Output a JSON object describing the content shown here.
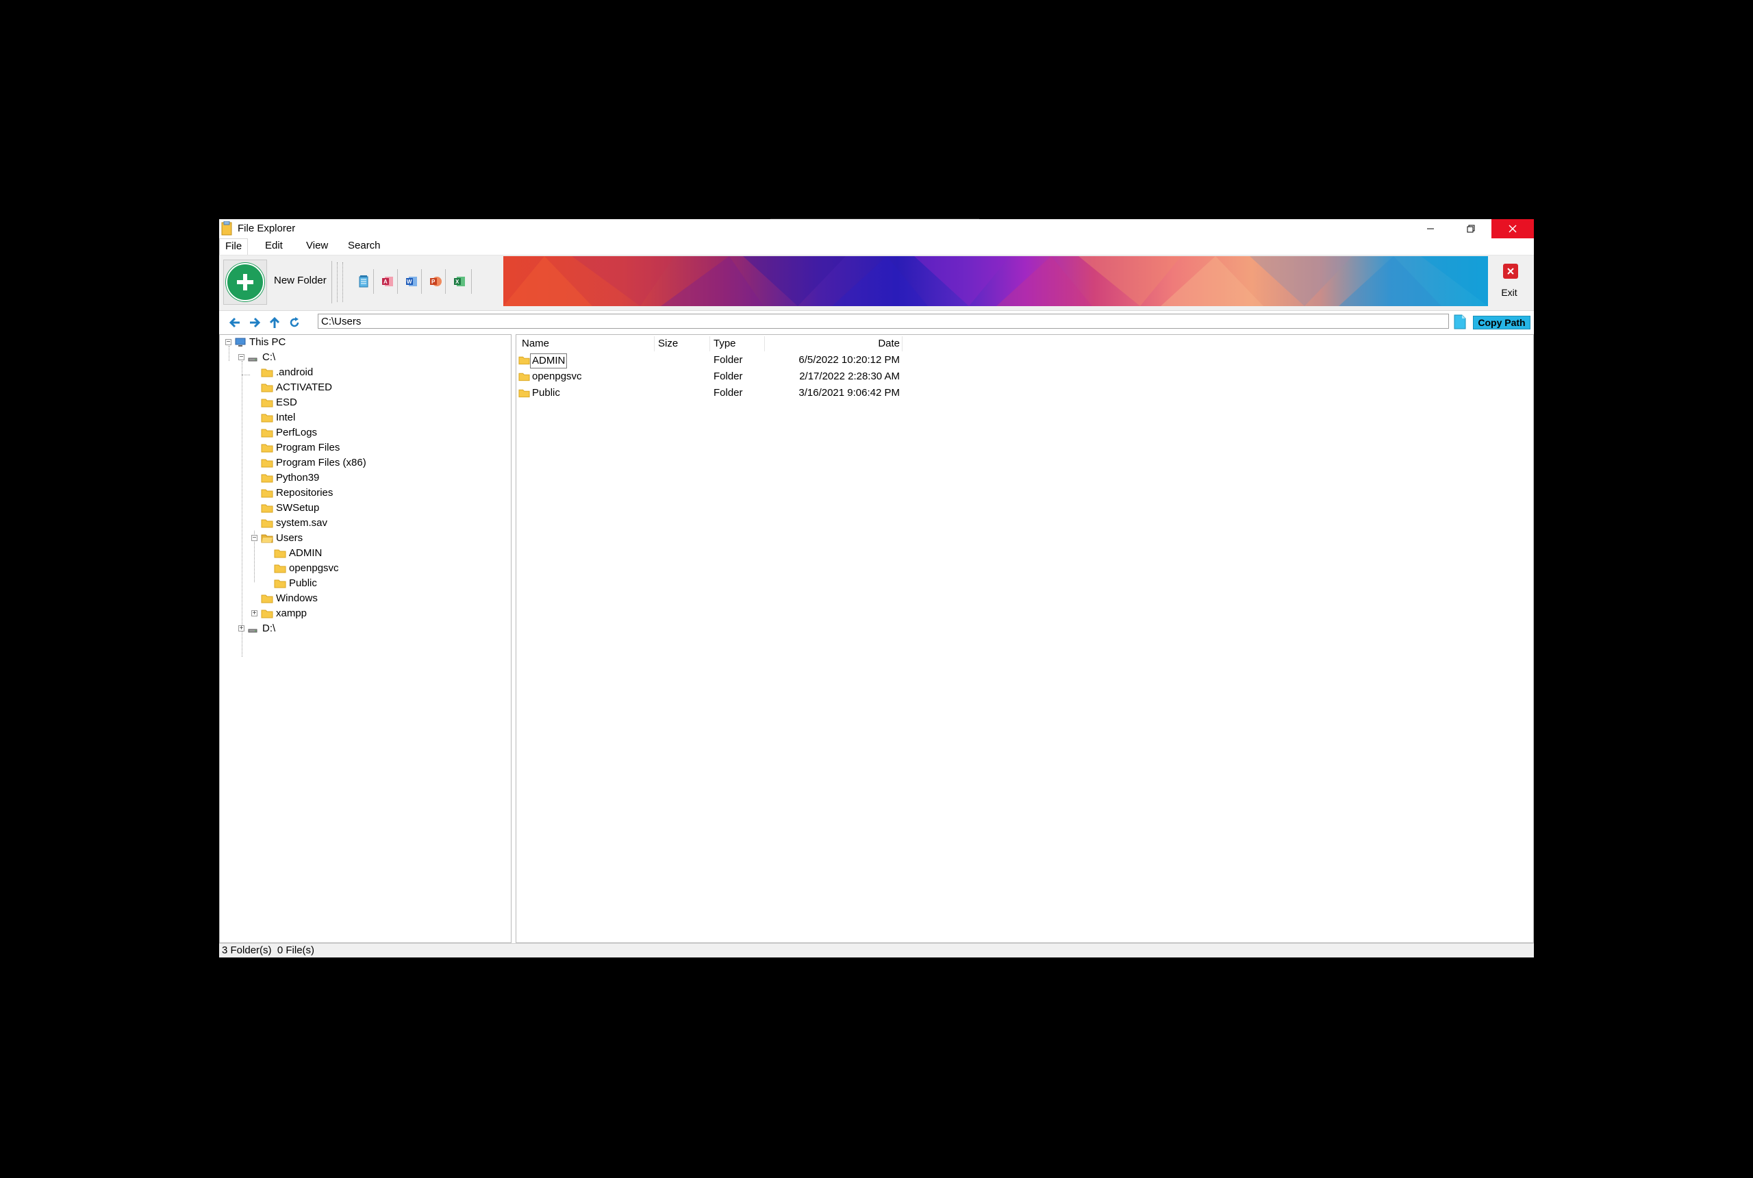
{
  "window": {
    "title": "File Explorer",
    "icons": {
      "app": "folder-app-icon",
      "minimize": "minimize-icon",
      "maximize": "restore-icon",
      "close": "close-icon"
    },
    "close_color": "#e81123"
  },
  "menu": {
    "items": [
      "File",
      "Edit",
      "View",
      "Search"
    ],
    "active": "File"
  },
  "toolbar": {
    "new_folder_label": "New Folder",
    "new_folder_color": "#1e9e5a",
    "apps": [
      "notepad-icon",
      "access-icon",
      "word-icon",
      "powerpoint-icon",
      "excel-icon"
    ],
    "exit_label": "Exit"
  },
  "address": {
    "path": "C:\\Users",
    "copy_label": "Copy Path",
    "copy_color": "#26b5e6",
    "nav_icons": [
      "back-arrow-icon",
      "forward-arrow-icon",
      "up-arrow-icon",
      "refresh-icon"
    ]
  },
  "tree": {
    "root": "This PC",
    "drive_c": "C:\\",
    "c_children": [
      ".android",
      "ACTIVATED",
      "ESD",
      "Intel",
      "PerfLogs",
      "Program Files",
      "Program Files (x86)",
      "Python39",
      "Repositories",
      "SWSetup",
      "system.sav",
      "Users",
      "Windows",
      "xampp"
    ],
    "users_children": [
      "ADMIN",
      "openpgsvc",
      "Public"
    ],
    "drive_d": "D:\\"
  },
  "list": {
    "columns": [
      "Name",
      "Size",
      "Type",
      "Date"
    ],
    "rows": [
      {
        "name": "ADMIN",
        "size": "",
        "type": "Folder",
        "date": "6/5/2022 10:20:12 PM"
      },
      {
        "name": "openpgsvc",
        "size": "",
        "type": "Folder",
        "date": "2/17/2022 2:28:30 AM"
      },
      {
        "name": "Public",
        "size": "",
        "type": "Folder",
        "date": "3/16/2021 9:06:42 PM"
      }
    ]
  },
  "status": {
    "text": "3 Folder(s)  0 File(s)"
  }
}
